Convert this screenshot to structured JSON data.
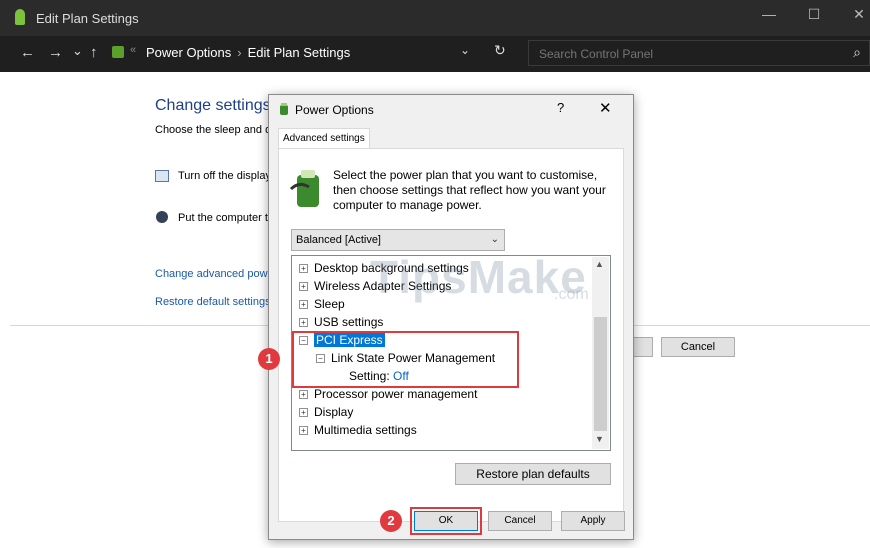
{
  "window": {
    "title": "Edit Plan Settings",
    "minimize": "—",
    "maximize": "☐",
    "close": "✕"
  },
  "nav": {
    "back": "←",
    "forward": "→",
    "dropdown": "⌄",
    "up": "↑",
    "refresh": "↻"
  },
  "breadcrumb": [
    "Power Options",
    "Edit Plan Settings"
  ],
  "search": {
    "placeholder": "Search Control Panel"
  },
  "background": {
    "title": "Change settings",
    "subtitle": "Choose the sleep and di",
    "display_label": "Turn off the display",
    "sleep_label": "Put the computer t",
    "link_advanced": "Change advanced powe",
    "link_restore": "Restore default settings",
    "cancel_label": "Cancel"
  },
  "dialog": {
    "title": "Power Options",
    "help": "?",
    "close": "✕",
    "tab": "Advanced settings",
    "description": "Select the power plan that you want to customise, then choose settings that reflect how you want your computer to manage power.",
    "plan_selected": "Balanced [Active]",
    "tree": [
      {
        "label": "Desktop background settings",
        "expander": "⊞"
      },
      {
        "label": "Wireless Adapter Settings",
        "expander": "⊞"
      },
      {
        "label": "Sleep",
        "expander": "⊞"
      },
      {
        "label": "USB settings",
        "expander": "⊞"
      },
      {
        "label": "PCI Express",
        "expander": "⊟",
        "selected": true
      },
      {
        "label": "Link State Power Management",
        "expander": "⊟"
      },
      {
        "label": "Setting:",
        "value": "Off"
      },
      {
        "label": "Processor power management",
        "expander": "⊞"
      },
      {
        "label": "Display",
        "expander": "⊞"
      },
      {
        "label": "Multimedia settings",
        "expander": "⊞"
      }
    ],
    "restore_label": "Restore plan defaults",
    "ok_label": "OK",
    "cancel_label": "Cancel",
    "apply_label": "Apply"
  },
  "annotations": {
    "badge1": "1",
    "badge2": "2"
  },
  "watermark": {
    "main": "TipsMake",
    "suffix": ".com"
  },
  "colors": {
    "accent": "#0078d7",
    "annotation": "#e0393e",
    "link": "#1a5aa6"
  }
}
